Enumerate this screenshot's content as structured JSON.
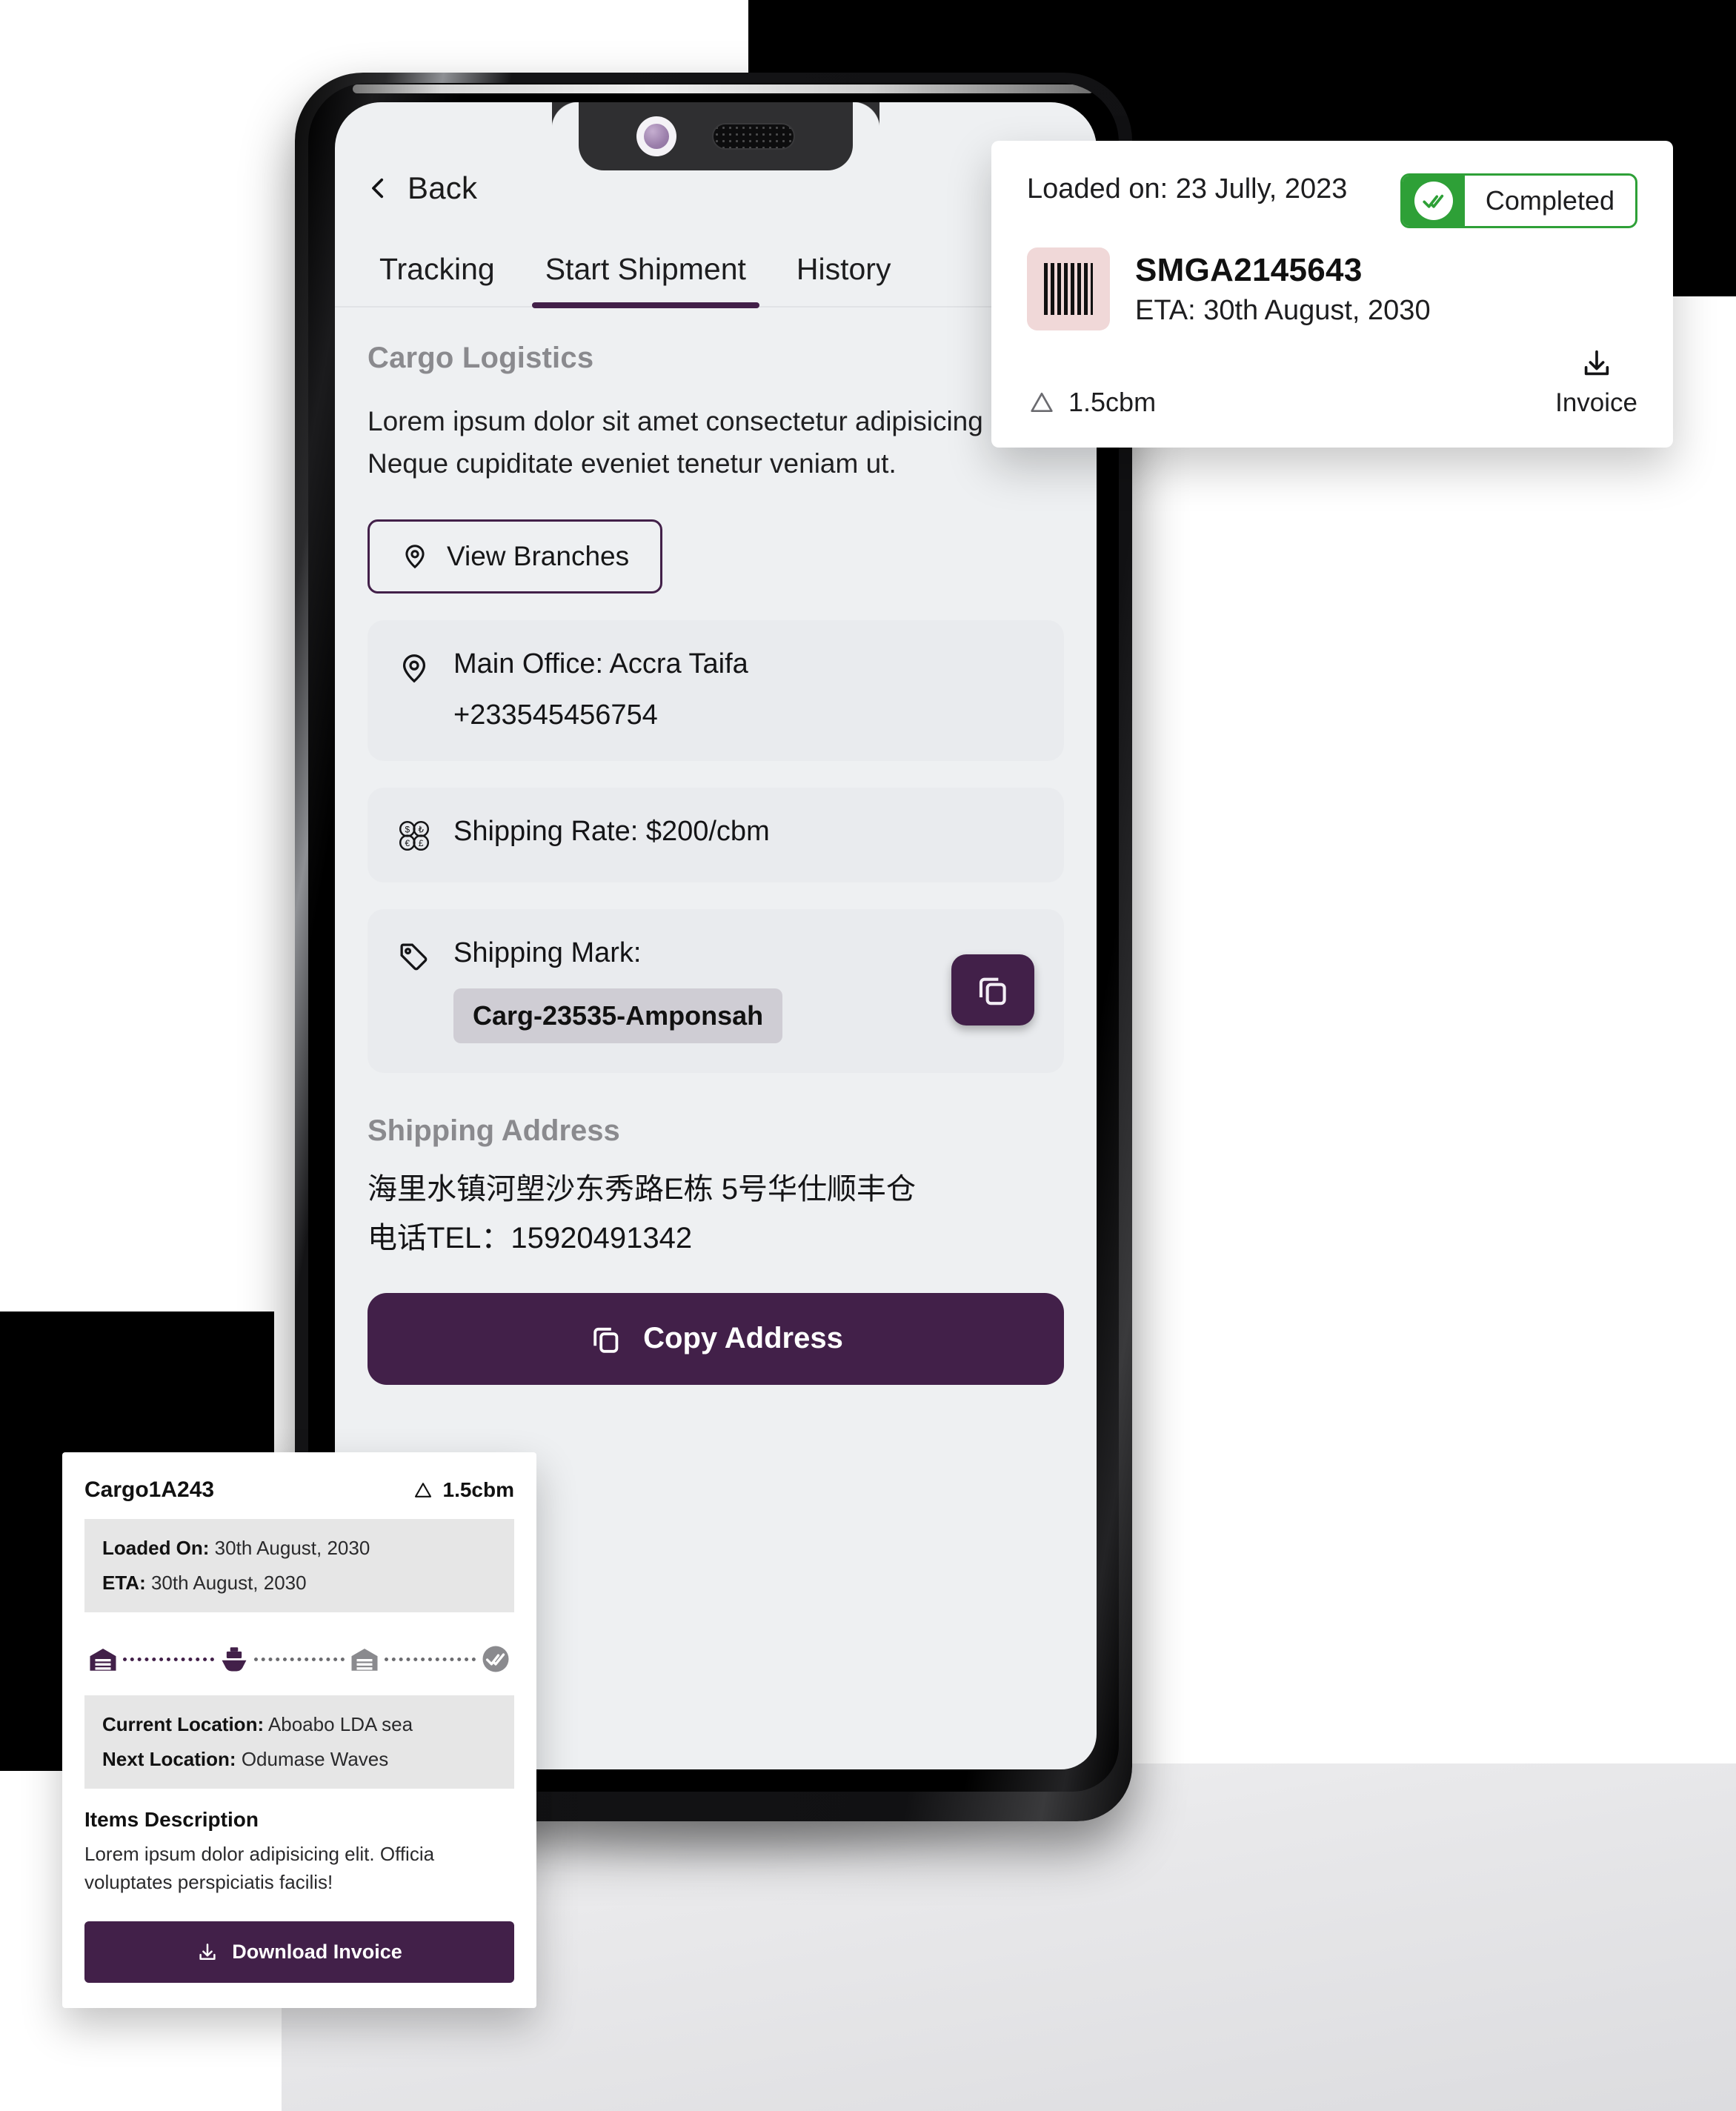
{
  "phone_app": {
    "nav": {
      "back_label": "Back"
    },
    "tabs": [
      {
        "label": "Tracking",
        "active": false
      },
      {
        "label": "Start Shipment",
        "active": true
      },
      {
        "label": "History",
        "active": false
      }
    ],
    "section_title": "Cargo Logistics",
    "description": "Lorem ipsum dolor sit amet consectetur adipisicing elit. Neque cupiditate eveniet tenetur veniam ut.",
    "view_branches_label": "View Branches",
    "office": {
      "line1": "Main Office: Accra Taifa",
      "line2": "+233545456754"
    },
    "shipping_rate": "Shipping Rate: $200/cbm",
    "shipping_mark": {
      "label": "Shipping Mark:",
      "value": "Carg-23535-Amponsah"
    },
    "shipping_address": {
      "title": "Shipping Address",
      "line1": "海里水镇河塱沙东秀路E栋 5号华仕顺丰仓",
      "line2": "电话TEL：15920491342"
    },
    "copy_address_label": "Copy Address"
  },
  "card_top": {
    "loaded_on": "Loaded on: 23 Jully, 2023",
    "status": "Completed",
    "tracking_code": "SMGA2145643",
    "eta": "ETA: 30th August, 2030",
    "volume": "1.5cbm",
    "invoice_label": "Invoice"
  },
  "card_bottom": {
    "title": "Cargo1A243",
    "volume": "1.5cbm",
    "loaded_on_label": "Loaded On:",
    "loaded_on_value": "30th August, 2030",
    "eta_label": "ETA:",
    "eta_value": "30th August, 2030",
    "current_location_label": "Current Location:",
    "current_location_value": "Aboabo LDA sea",
    "next_location_label": "Next Location:",
    "next_location_value": "Odumase Waves",
    "items_title": "Items Description",
    "items_desc": "Lorem ipsum dolor adipisicing elit. Officia voluptates perspiciatis facilis!",
    "download_label": "Download Invoice"
  },
  "colors": {
    "accent_purple": "#422049",
    "status_green": "#2ea037",
    "muted_grey": "#8a8a8e",
    "chip_grey": "#cfcdd4",
    "barcode_bg": "#f0d8d8"
  }
}
